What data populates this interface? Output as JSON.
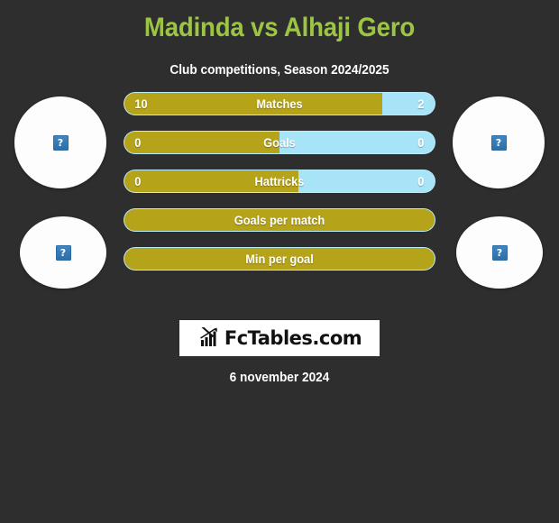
{
  "header": {
    "title": "Madinda vs Alhaji Gero",
    "subtitle": "Club competitions, Season 2024/2025"
  },
  "colors": {
    "background": "#2e2e2e",
    "title": "#9dc544",
    "home": "#b5a31a",
    "away": "#a8e4f7",
    "text": "#ffffff"
  },
  "players": {
    "home": {
      "avatar_top": "broken-image-icon",
      "avatar_bottom": "broken-image-icon"
    },
    "away": {
      "avatar_top": "broken-image-icon",
      "avatar_bottom": "broken-image-icon"
    }
  },
  "icons": {
    "broken_image_glyph": "?",
    "logo_icon": "bar-chart-growth-icon"
  },
  "footer": {
    "logo_text": "FcTables.com",
    "date": "6 november 2024"
  },
  "chart_data": {
    "type": "bar",
    "title": "Madinda vs Alhaji Gero",
    "subtitle": "Club competitions, Season 2024/2025",
    "orientation": "horizontal-diverging",
    "legend": [
      "Madinda",
      "Alhaji Gero"
    ],
    "categories": [
      "Matches",
      "Goals",
      "Hattricks",
      "Goals per match",
      "Min per goal"
    ],
    "series": [
      {
        "name": "Madinda",
        "color": "#b5a31a",
        "values": [
          "10",
          "0",
          "0",
          "",
          ""
        ]
      },
      {
        "name": "Alhaji Gero",
        "color": "#a8e4f7",
        "values": [
          "2",
          "0",
          "0",
          "",
          ""
        ]
      }
    ],
    "rows": [
      {
        "label": "Matches",
        "home": "10",
        "away": "2",
        "home_pct": 83,
        "show_values": true
      },
      {
        "label": "Goals",
        "home": "0",
        "away": "0",
        "home_pct": 50,
        "show_values": true
      },
      {
        "label": "Hattricks",
        "home": "0",
        "away": "0",
        "home_pct": 56,
        "show_values": true
      },
      {
        "label": "Goals per match",
        "home": "",
        "away": "",
        "home_pct": 100,
        "show_values": false
      },
      {
        "label": "Min per goal",
        "home": "",
        "away": "",
        "home_pct": 100,
        "show_values": false
      }
    ],
    "xlabel": "",
    "ylabel": "",
    "grid": false
  }
}
